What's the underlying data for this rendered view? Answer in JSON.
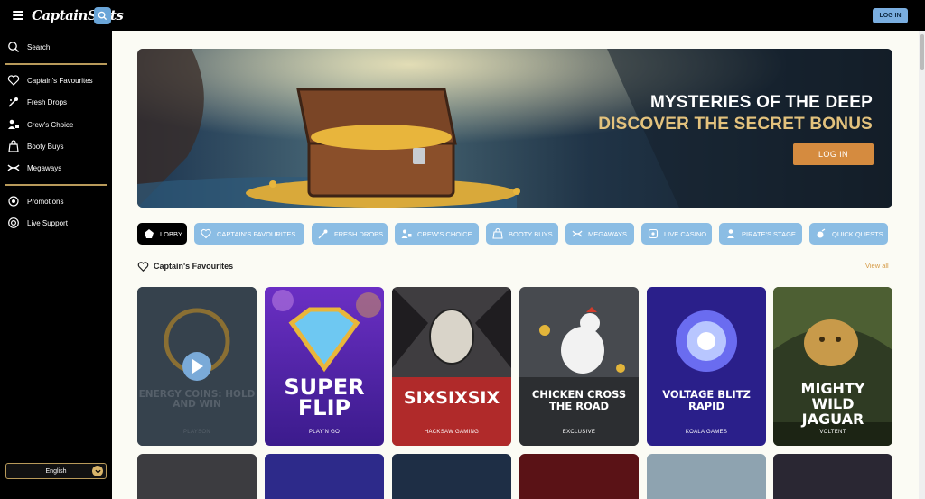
{
  "header": {
    "logo": "CaptainSlots",
    "login_label": "LOG IN"
  },
  "sidebar": {
    "search_label": "Search",
    "items": [
      {
        "label": "Captain's Favourites",
        "icon": "heart-icon"
      },
      {
        "label": "Fresh Drops",
        "icon": "fresh-drops-icon"
      },
      {
        "label": "Crew's Choice",
        "icon": "crew-icon"
      },
      {
        "label": "Booty Buys",
        "icon": "bag-icon"
      },
      {
        "label": "Megaways",
        "icon": "megaways-icon"
      }
    ],
    "secondary": [
      {
        "label": "Promotions",
        "icon": "gear-icon"
      },
      {
        "label": "Live Support",
        "icon": "support-icon"
      }
    ],
    "language": "English"
  },
  "hero": {
    "title_line1": "MYSTERIES OF THE DEEP",
    "title_line2": "DISCOVER THE SECRET BONUS",
    "button_label": "LOG IN"
  },
  "chips": [
    {
      "label": "LOBBY",
      "active": true
    },
    {
      "label": "CAPTAIN'S FAVOURITES"
    },
    {
      "label": "FRESH DROPS"
    },
    {
      "label": "CREW'S CHOICE"
    },
    {
      "label": "BOOTY BUYS"
    },
    {
      "label": "MEGAWAYS"
    },
    {
      "label": "LIVE CASINO"
    },
    {
      "label": "PIRATE'S STAGE"
    },
    {
      "label": "QUICK QUESTS"
    }
  ],
  "section": {
    "title": "Captain's Favourites",
    "view_all": "View all"
  },
  "games": [
    {
      "title": "ENERGY COINS: HOLD AND WIN",
      "provider": "PLAYSON"
    },
    {
      "title": "SUPER FLIP",
      "provider": "PLAY'N GO"
    },
    {
      "title": "SIXSIXSIX",
      "provider": "HACKSAW GAMING"
    },
    {
      "title": "CHICKEN CROSS THE ROAD",
      "provider": "EXCLUSIVE"
    },
    {
      "title": "VOLTAGE BLITZ RAPID",
      "provider": "KOALA GAMES"
    },
    {
      "title": "MIGHTY WILD JAGUAR",
      "provider": "VOLTENT"
    }
  ],
  "colors": {
    "accent_gold": "#b89a5a",
    "chip_blue": "#8bbde4",
    "login_orange": "#d58b3f"
  }
}
